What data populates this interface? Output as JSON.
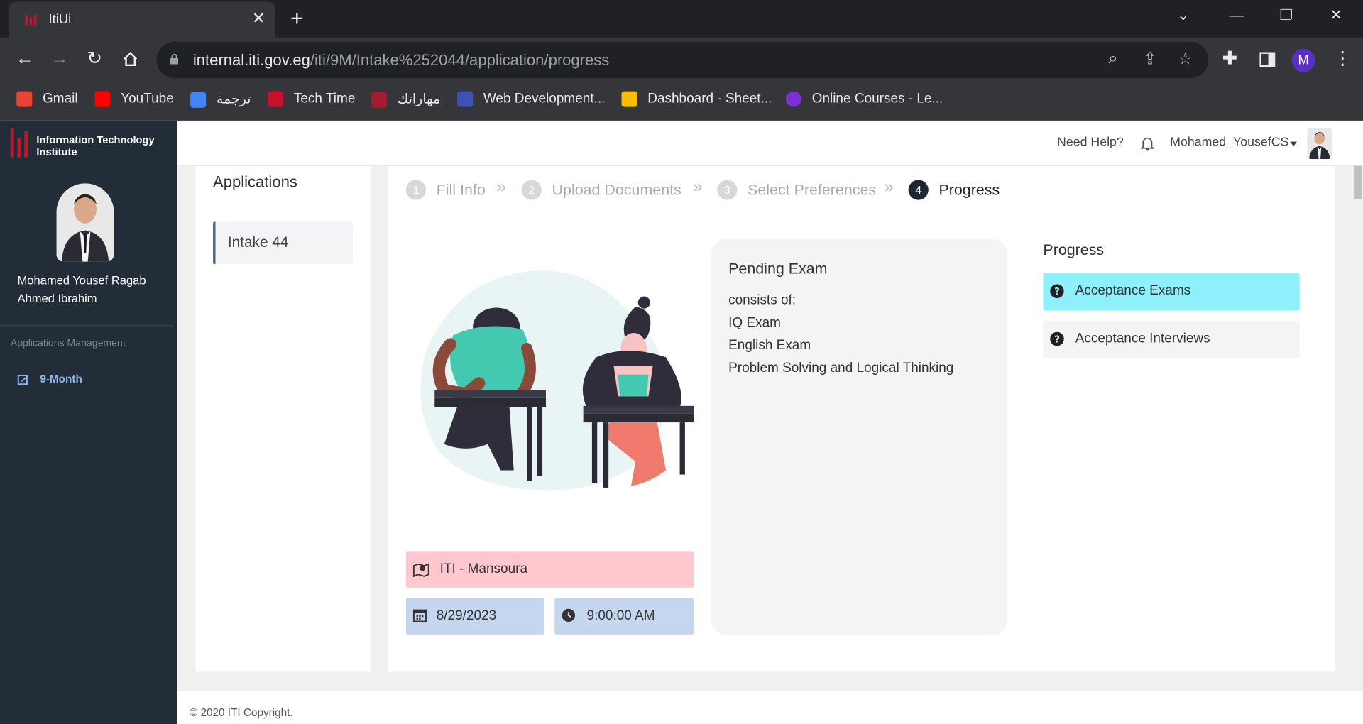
{
  "browser": {
    "tab_title": "ItiUi",
    "url_host": "internal.iti.gov.eg",
    "url_path": "/iti/9M/Intake%252044/application/progress",
    "profile_initial": "M"
  },
  "bookmarks": [
    {
      "label": "Gmail",
      "color": "#ea4335"
    },
    {
      "label": "YouTube",
      "color": "#ff0000"
    },
    {
      "label": "ترجمة",
      "color": "#4285f4"
    },
    {
      "label": "Tech Time",
      "color": "#c8102e"
    },
    {
      "label": "مهاراتك",
      "color": "#a6192e"
    },
    {
      "label": "Web Development...",
      "color": "#3f51b5"
    },
    {
      "label": "Dashboard - Sheet...",
      "color": "#fbbc04"
    },
    {
      "label": "Online Courses - Le...",
      "color": "#7b2fd6"
    }
  ],
  "sidebar": {
    "logo_line1": "Information Technology",
    "logo_line2": "Institute",
    "user_line1": "Mohamed Yousef Ragab",
    "user_line2": "Ahmed Ibrahim",
    "section": "Applications Management",
    "link": "9-Month"
  },
  "topnav": {
    "help": "Need Help?",
    "username": "Mohamed_YousefCS"
  },
  "applications": {
    "title": "Applications",
    "item": "Intake 44"
  },
  "steps": [
    {
      "num": "1",
      "label": "Fill Info"
    },
    {
      "num": "2",
      "label": "Upload Documents"
    },
    {
      "num": "3",
      "label": "Select Preferences"
    },
    {
      "num": "4",
      "label": "Progress"
    }
  ],
  "exam_info": {
    "location": "ITI - Mansoura",
    "date": "8/29/2023",
    "time": "9:00:00 AM"
  },
  "exam_card": {
    "title": "Pending Exam",
    "lines": [
      "consists of:",
      "IQ Exam",
      "English Exam",
      "Problem Solving and Logical Thinking"
    ]
  },
  "progress": {
    "title": "Progress",
    "items": [
      "Acceptance Exams",
      "Acceptance Interviews"
    ]
  },
  "footer": "© 2020 ITI Copyright."
}
